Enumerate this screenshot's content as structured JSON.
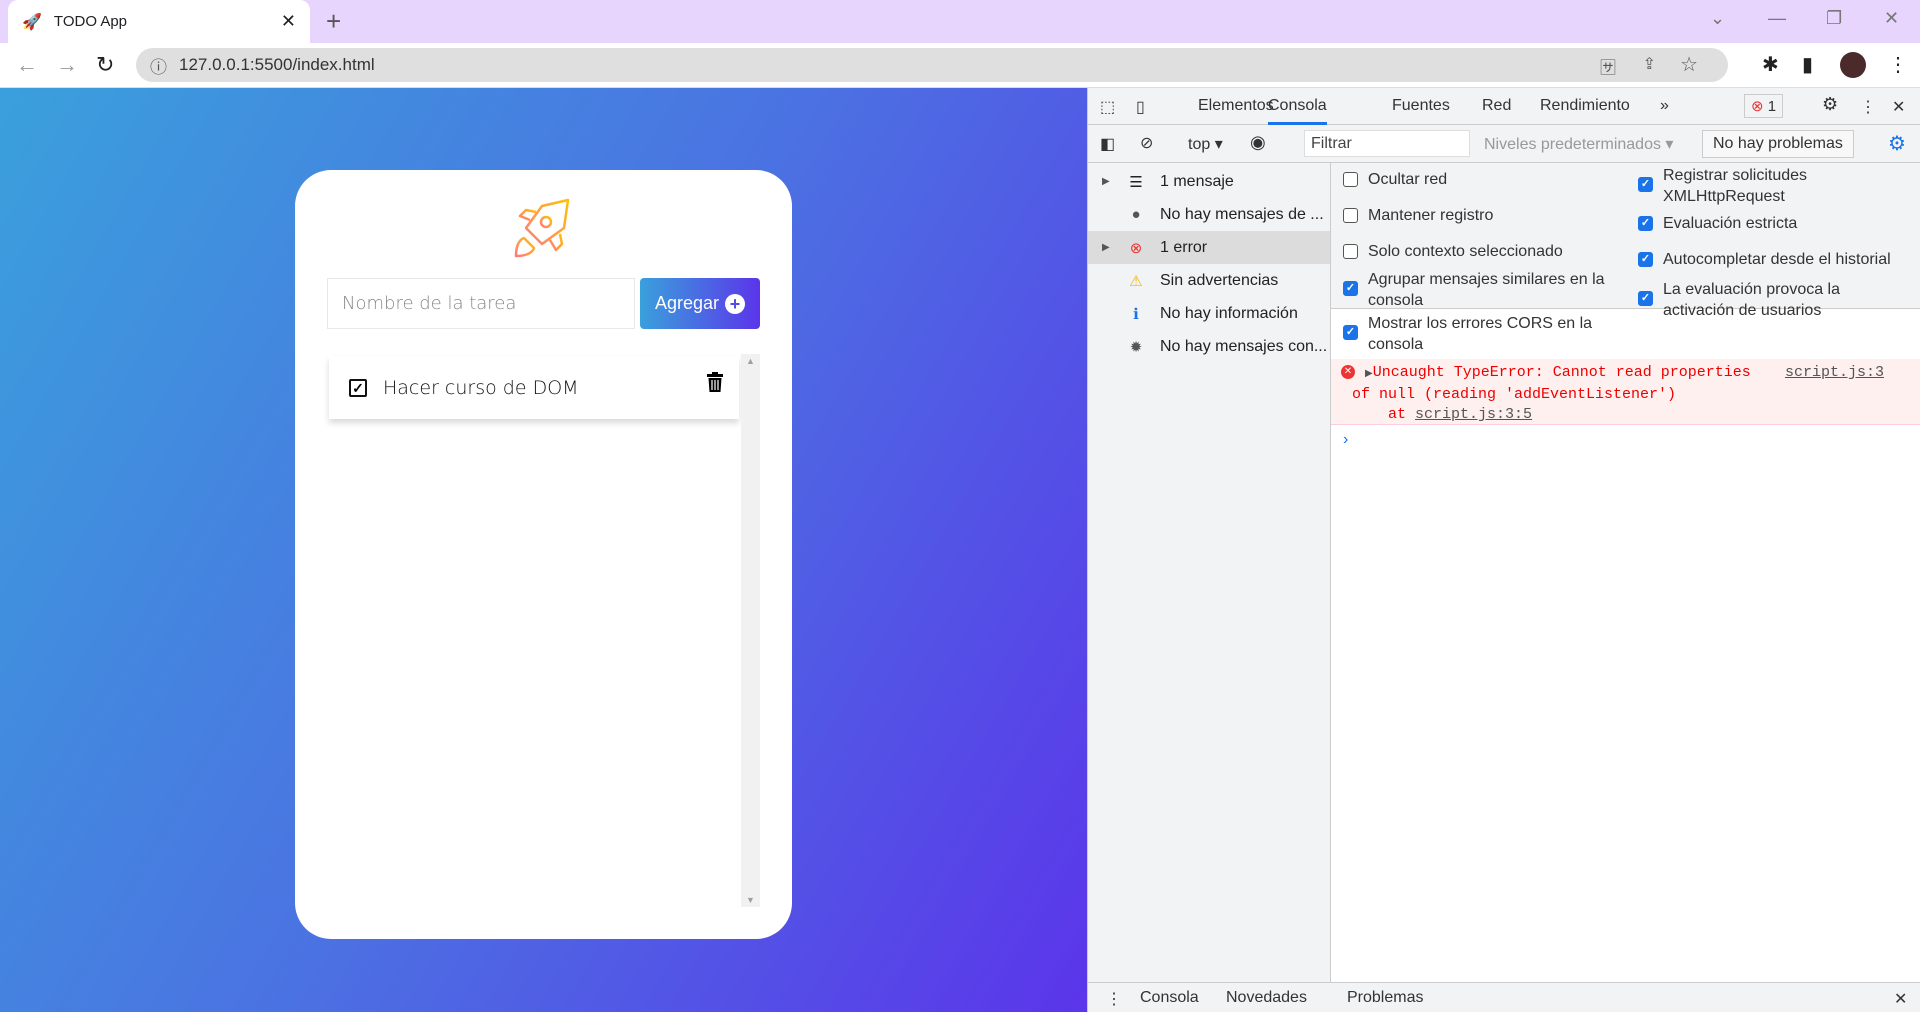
{
  "browser": {
    "tab_title": "TODO App",
    "url": "127.0.0.1:5500/index.html",
    "new_tab": "+",
    "tab_close": "✕"
  },
  "app": {
    "input_placeholder": "Nombre de la tarea",
    "add_label": "Agregar",
    "tasks": [
      {
        "text": "Hacer curso de DOM",
        "done": true
      }
    ],
    "colors": {
      "gradient_start": "#3aa0dc",
      "gradient_end": "#5b35ea",
      "rocket": "#ffa940"
    }
  },
  "devtools": {
    "tabs": [
      "Elementos",
      "Consola",
      "Fuentes",
      "Red",
      "Rendimiento"
    ],
    "active_tab": "Consola",
    "error_count": "1",
    "context": "top",
    "filter_placeholder": "Filtrar",
    "levels": "Niveles predeterminados",
    "issues": "No hay problemas",
    "sidebar": [
      {
        "label": "1 mensaje",
        "icon": "list-icon"
      },
      {
        "label": "No hay mensajes de ...",
        "icon": "user-icon"
      },
      {
        "label": "1 error",
        "icon": "error-icon"
      },
      {
        "label": "Sin advertencias",
        "icon": "warning-icon"
      },
      {
        "label": "No hay información",
        "icon": "info-icon"
      },
      {
        "label": "No hay mensajes con...",
        "icon": "bug-icon"
      }
    ],
    "settings_left": [
      {
        "label": "Ocultar red",
        "checked": false
      },
      {
        "label": "Mantener registro",
        "checked": false
      },
      {
        "label": "Solo contexto seleccionado",
        "checked": false
      },
      {
        "label": "Agrupar mensajes similares en la consola",
        "checked": true
      },
      {
        "label": "Mostrar los errores CORS en la consola",
        "checked": true
      }
    ],
    "settings_right": [
      {
        "label": "Registrar solicitudes XMLHttpRequest",
        "checked": true
      },
      {
        "label": "Evaluación estricta",
        "checked": true
      },
      {
        "label": "Autocompletar desde el historial",
        "checked": true
      },
      {
        "label": "La evaluación provoca la activación de usuarios",
        "checked": true
      }
    ],
    "error": {
      "line1": "Uncaught TypeError: Cannot read properties",
      "line2": "of null (reading 'addEventListener')",
      "at": "at ",
      "at_link": "script.js:3:5",
      "source": "script.js:3"
    },
    "drawer_tabs": [
      "Consola",
      "Novedades",
      "Problemas"
    ]
  }
}
